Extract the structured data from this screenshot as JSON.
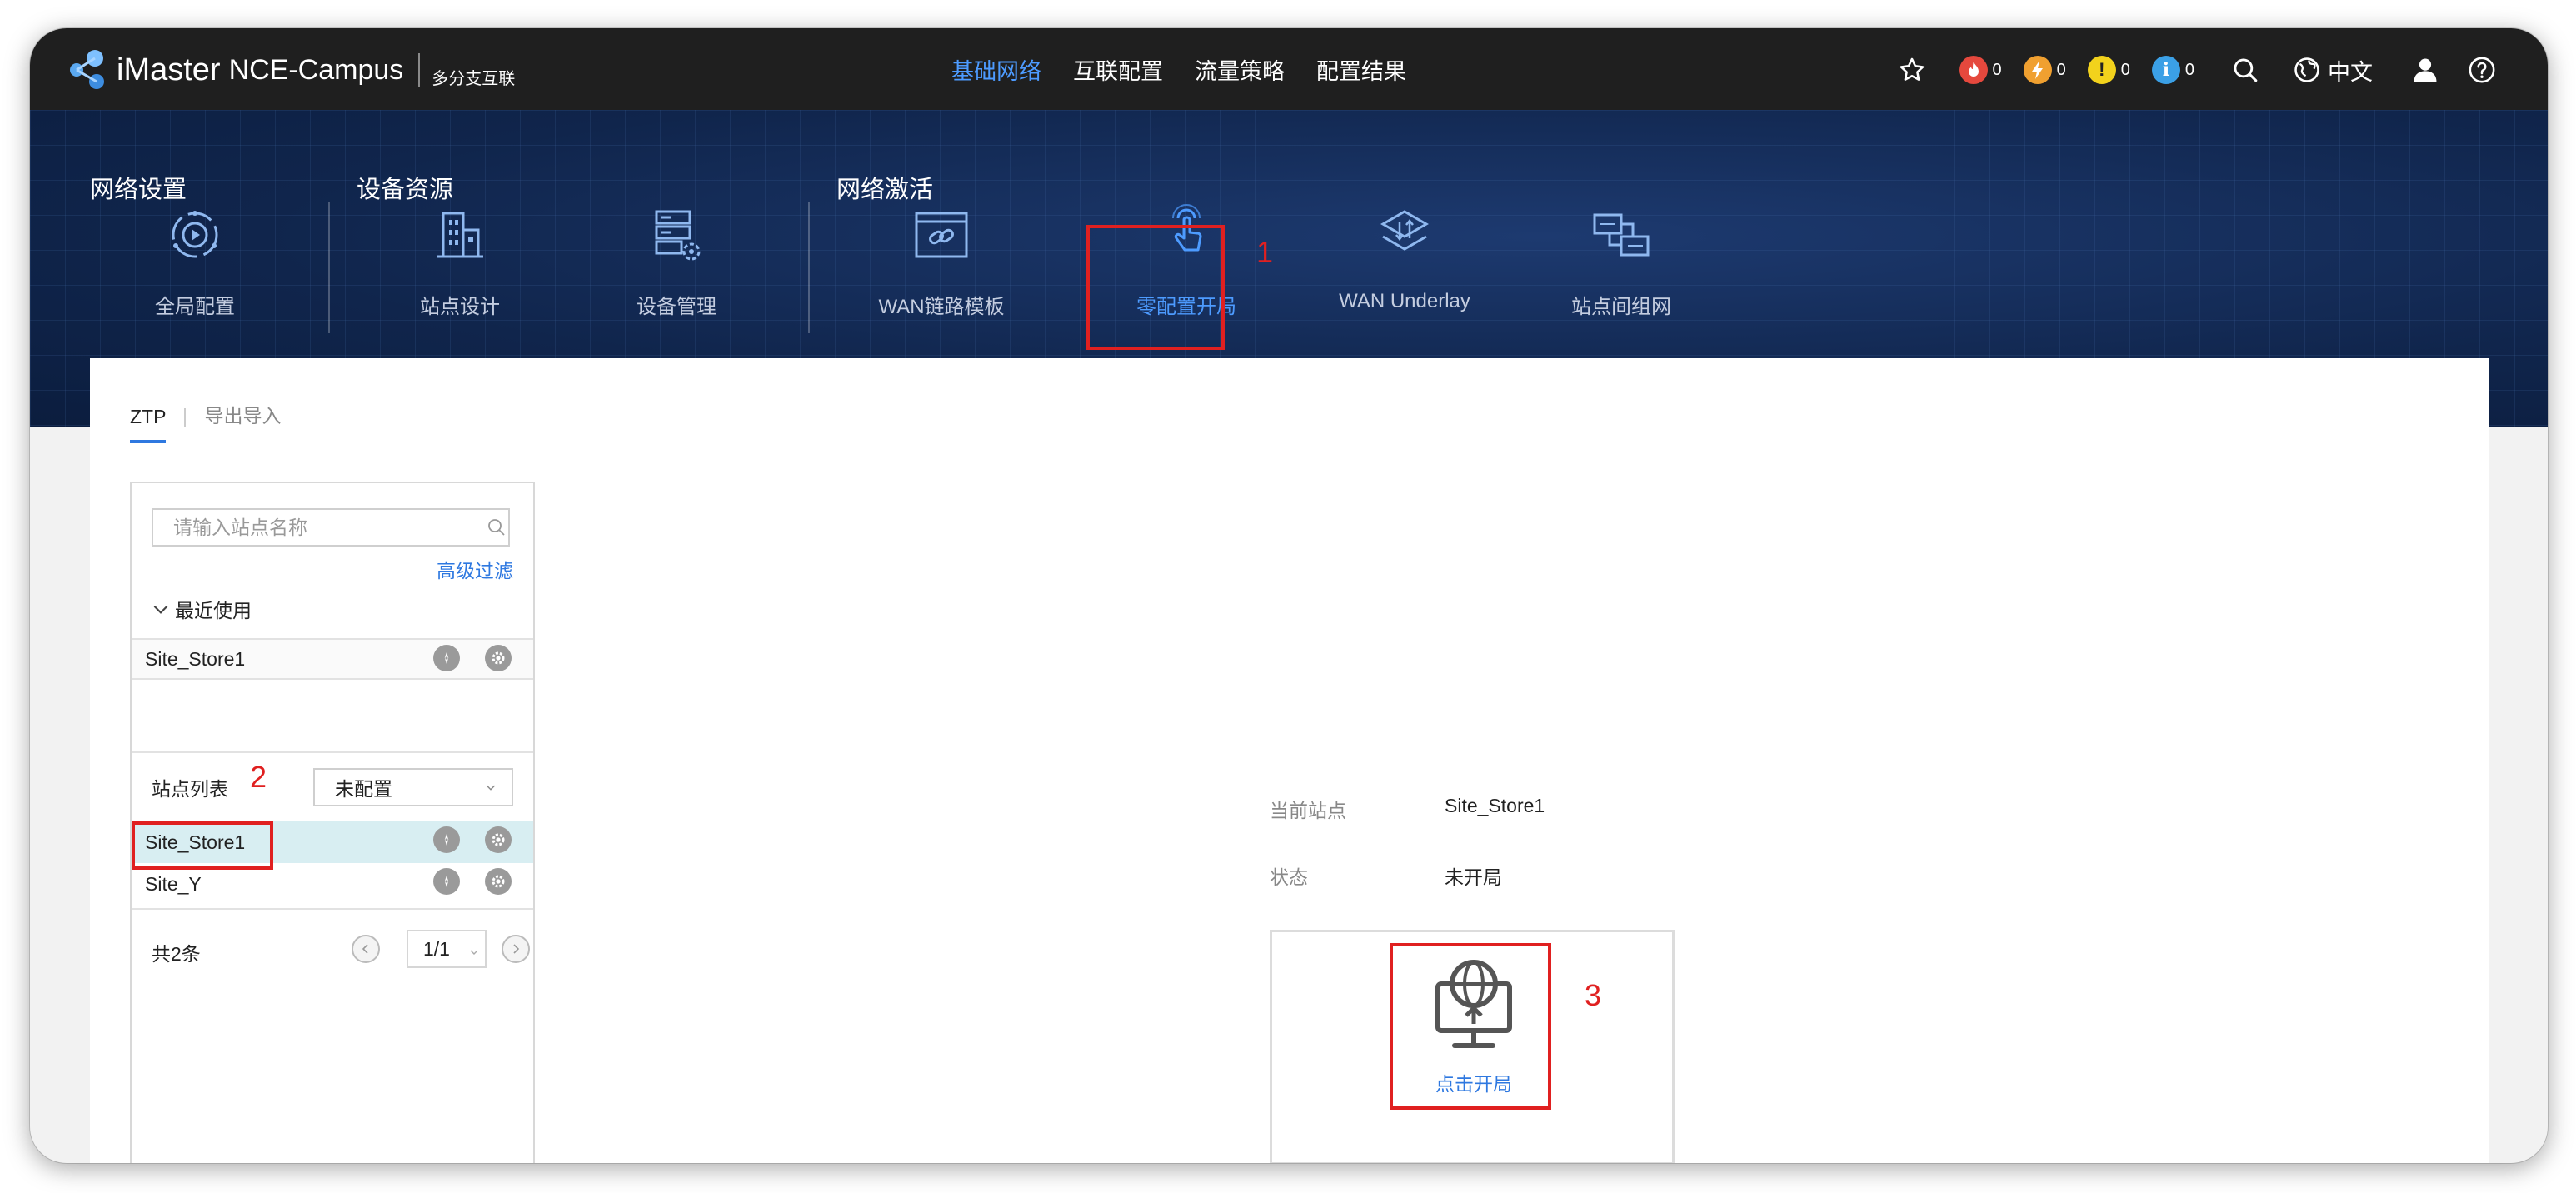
{
  "header": {
    "brand": "iMaster",
    "product": "NCE-Campus",
    "scenario": "多分支互联",
    "nav": [
      {
        "label": "基础网络",
        "active": true
      },
      {
        "label": "互联配置",
        "active": false
      },
      {
        "label": "流量策略",
        "active": false
      },
      {
        "label": "配置结果",
        "active": false
      }
    ],
    "alarms": {
      "critical": {
        "count": "0",
        "color": "#e5483d",
        "icon": "fire-icon"
      },
      "major": {
        "count": "0",
        "color": "#f0a030",
        "icon": "bolt-icon"
      },
      "minor": {
        "count": "0",
        "color": "#f2d21c",
        "icon": "exclamation-icon"
      },
      "info": {
        "count": "0",
        "color": "#3ba0e6",
        "icon": "info-icon"
      }
    },
    "language": "中文",
    "accent_color": "#4d9bff"
  },
  "banner": {
    "groups": {
      "network_settings": "网络设置",
      "device_resources": "设备资源",
      "network_activation": "网络激活"
    },
    "functions": {
      "global_config": "全局配置",
      "site_design": "站点设计",
      "device_management": "设备管理",
      "wan_link_template": "WAN链路模板",
      "zero_touch": "零配置开局",
      "wan_underlay": "WAN Underlay",
      "site_interconnect": "站点间组网"
    },
    "active_function": "零配置开局"
  },
  "annotations": {
    "step1": "1",
    "step2": "2",
    "step3": "3"
  },
  "tabs": {
    "ztp": "ZTP",
    "export_import": "导出导入"
  },
  "sidebar": {
    "search_placeholder": "请输入站点名称",
    "advanced_filter": "高级过滤",
    "recent_title": "最近使用",
    "recent_items": [
      "Site_Store1"
    ],
    "site_list_label": "站点列表",
    "filter_value": "未配置",
    "sites": [
      "Site_Store1",
      "Site_Y"
    ],
    "selected_site": "Site_Store1",
    "total": "共2条",
    "page": "1/1"
  },
  "detail": {
    "current_site_label": "当前站点",
    "current_site_value": "Site_Store1",
    "status_label": "状态",
    "status_value": "未开局",
    "start_button": "点击开局"
  }
}
